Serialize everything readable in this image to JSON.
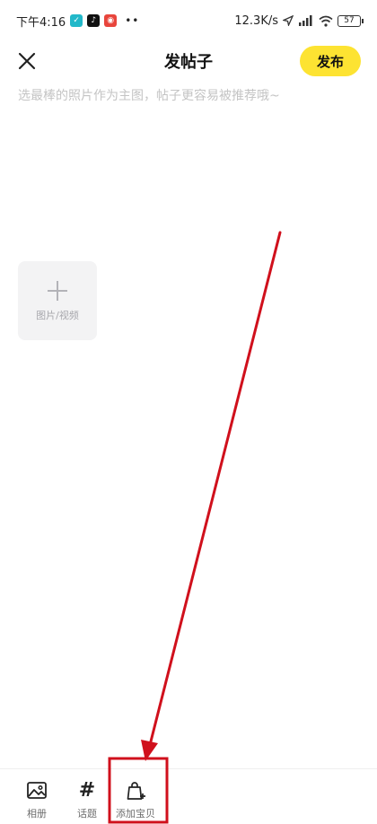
{
  "status_bar": {
    "time": "下午4:16",
    "dots": "••",
    "network_speed": "12.3K/s",
    "battery": "57",
    "app_icons": [
      "chat-app-icon",
      "tiktok-icon",
      "red-app-icon"
    ],
    "colors": {
      "chat_app": "#22b8c9",
      "tiktok": "#111111",
      "red_app": "#e8453c"
    }
  },
  "header": {
    "title": "发帖子",
    "publish_label": "发布",
    "close_icon": "close-icon",
    "accent_color": "#fde332"
  },
  "editor": {
    "placeholder": "选最棒的照片作为主图，帖子更容易被推荐哦~"
  },
  "media_picker": {
    "label": "图片/视频",
    "icon": "plus-icon"
  },
  "toolbar": {
    "items": [
      {
        "label": "相册",
        "icon": "image-icon"
      },
      {
        "label": "话题",
        "icon": "hash-icon"
      },
      {
        "label": "添加宝贝",
        "icon": "shopping-bag-add-icon"
      }
    ]
  },
  "annotation": {
    "color": "#d0101c",
    "type": "arrow-and-box"
  }
}
